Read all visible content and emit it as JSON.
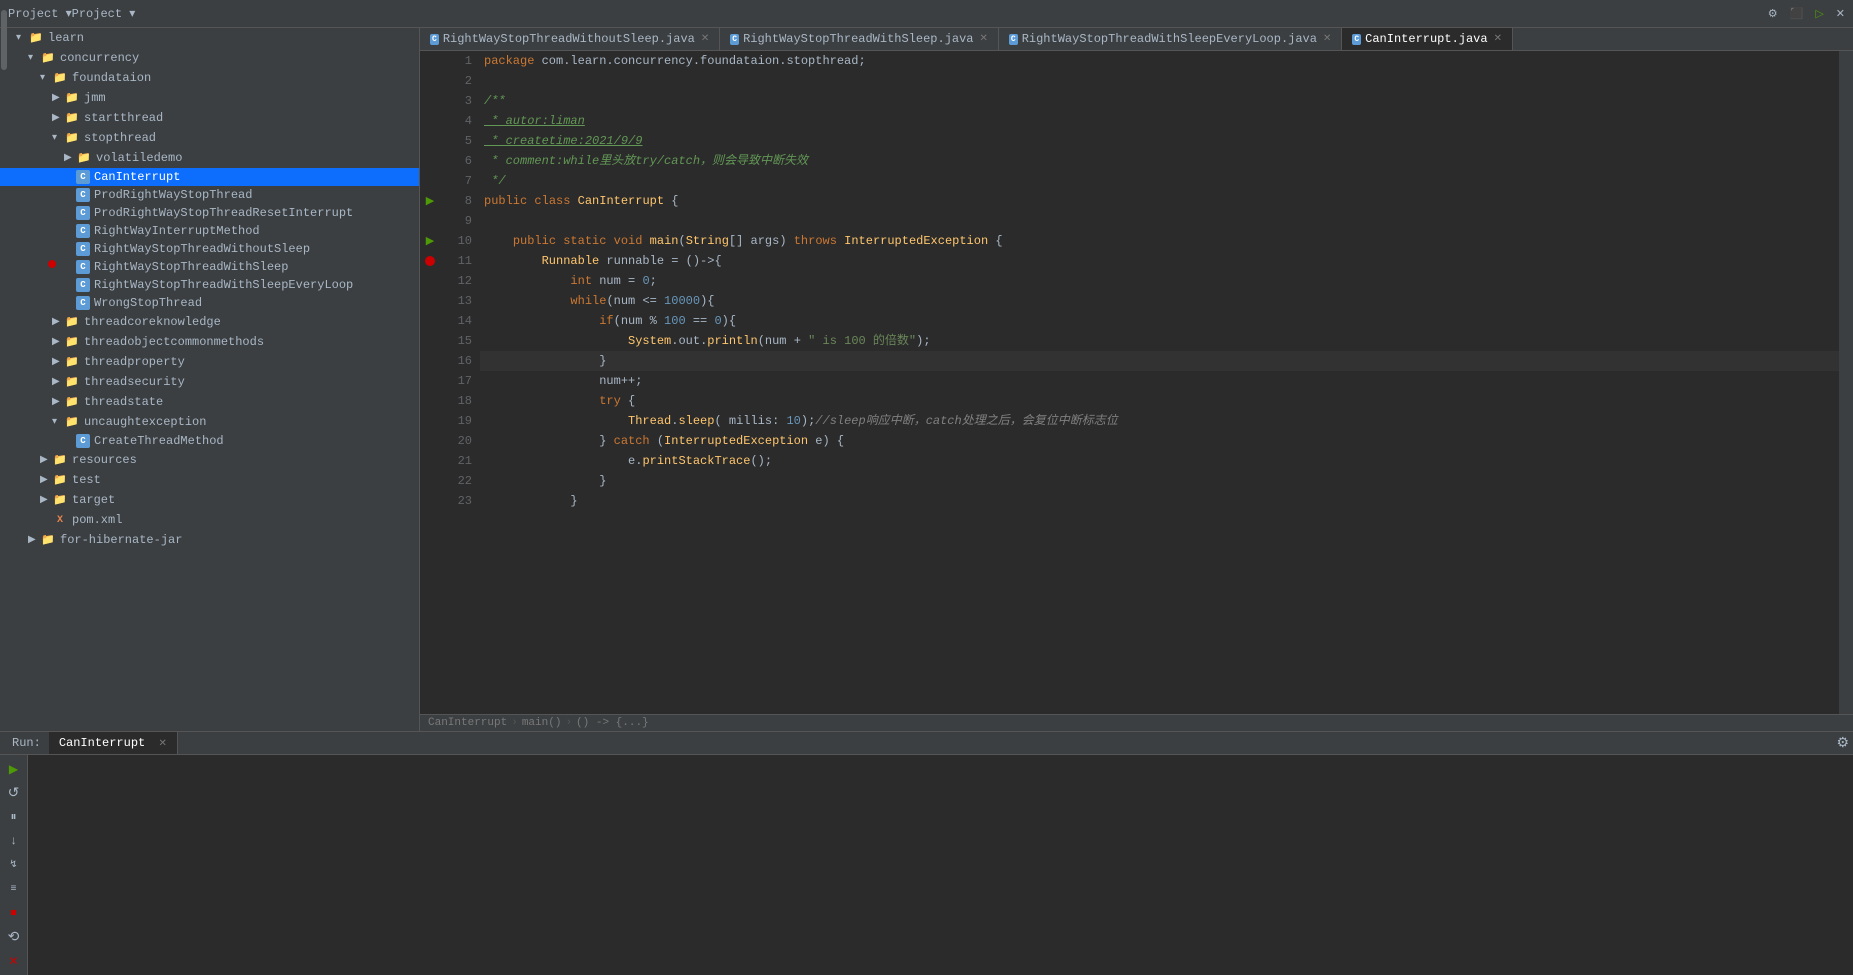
{
  "topbar": {
    "title": "Project ▾",
    "icons": [
      "⚙",
      "⬛",
      "▷",
      "✕"
    ]
  },
  "sidebar": {
    "items": [
      {
        "id": "learn",
        "label": "learn",
        "indent": 1,
        "type": "folder",
        "expanded": true,
        "arrow": "▾"
      },
      {
        "id": "concurrency",
        "label": "concurrency",
        "indent": 2,
        "type": "folder",
        "expanded": true,
        "arrow": "▾"
      },
      {
        "id": "foundataion",
        "label": "foundataion",
        "indent": 3,
        "type": "folder",
        "expanded": true,
        "arrow": "▾"
      },
      {
        "id": "jmm",
        "label": "jmm",
        "indent": 4,
        "type": "folder",
        "expanded": false,
        "arrow": "▶"
      },
      {
        "id": "startthread",
        "label": "startthread",
        "indent": 4,
        "type": "folder",
        "expanded": false,
        "arrow": "▶"
      },
      {
        "id": "stopthread",
        "label": "stopthread",
        "indent": 4,
        "type": "folder",
        "expanded": true,
        "arrow": "▾"
      },
      {
        "id": "volatiledemo",
        "label": "volatiledemo",
        "indent": 5,
        "type": "folder",
        "expanded": false,
        "arrow": "▶"
      },
      {
        "id": "CanInterrupt",
        "label": "CanInterrupt",
        "indent": 5,
        "type": "java",
        "selected": true
      },
      {
        "id": "ProdRightWayStopThread",
        "label": "ProdRightWayStopThread",
        "indent": 5,
        "type": "java"
      },
      {
        "id": "ProdRightWayStopThreadResetInterrupt",
        "label": "ProdRightWayStopThreadResetInterrupt",
        "indent": 5,
        "type": "java"
      },
      {
        "id": "RightWayInterruptMethod",
        "label": "RightWayInterruptMethod",
        "indent": 5,
        "type": "java"
      },
      {
        "id": "RightWayStopThreadWithoutSleep",
        "label": "RightWayStopThreadWithoutSleep",
        "indent": 5,
        "type": "java"
      },
      {
        "id": "RightWayStopThreadWithSleep",
        "label": "RightWayStopThreadWithSleep",
        "indent": 5,
        "type": "java"
      },
      {
        "id": "RightWayStopThreadWithSleepEveryLoop",
        "label": "RightWayStopThreadWithSleepEveryLoop",
        "indent": 5,
        "type": "java"
      },
      {
        "id": "WrongStopThread",
        "label": "WrongStopThread",
        "indent": 5,
        "type": "java"
      },
      {
        "id": "threadcoreknowledge",
        "label": "threadcoreknowledge",
        "indent": 4,
        "type": "folder",
        "expanded": false,
        "arrow": "▶"
      },
      {
        "id": "threadobjectcommonmethods",
        "label": "threadobjectcommonmethods",
        "indent": 4,
        "type": "folder",
        "expanded": false,
        "arrow": "▶"
      },
      {
        "id": "threadproperty",
        "label": "threadproperty",
        "indent": 4,
        "type": "folder",
        "expanded": false,
        "arrow": "▶"
      },
      {
        "id": "threadsecurity",
        "label": "threadsecurity",
        "indent": 4,
        "type": "folder",
        "expanded": false,
        "arrow": "▶"
      },
      {
        "id": "threadstate",
        "label": "threadstate",
        "indent": 4,
        "type": "folder",
        "expanded": false,
        "arrow": "▶"
      },
      {
        "id": "uncaughtexception",
        "label": "uncaughtexception",
        "indent": 4,
        "type": "folder",
        "expanded": true,
        "arrow": "▾"
      },
      {
        "id": "CreateThreadMethod",
        "label": "CreateThreadMethod",
        "indent": 5,
        "type": "java"
      },
      {
        "id": "resources",
        "label": "resources",
        "indent": 3,
        "type": "folder",
        "expanded": false,
        "arrow": "▶"
      },
      {
        "id": "test",
        "label": "test",
        "indent": 3,
        "type": "folder",
        "expanded": false,
        "arrow": "▶"
      },
      {
        "id": "target",
        "label": "target",
        "indent": 3,
        "type": "folder",
        "expanded": false,
        "arrow": "▶"
      },
      {
        "id": "pom.xml",
        "label": "pom.xml",
        "indent": 3,
        "type": "xml"
      },
      {
        "id": "for-hibernate-jar",
        "label": "for-hibernate-jar",
        "indent": 2,
        "type": "folder",
        "expanded": false,
        "arrow": "▶"
      }
    ]
  },
  "tabs": [
    {
      "id": "tab1",
      "label": "RightWayStopThreadWithoutSleep.java",
      "active": false,
      "closable": true
    },
    {
      "id": "tab2",
      "label": "RightWayStopThreadWithSleep.java",
      "active": false,
      "closable": true
    },
    {
      "id": "tab3",
      "label": "RightWayStopThreadWithSleepEveryLoop.java",
      "active": false,
      "closable": true
    },
    {
      "id": "tab4",
      "label": "CanInterrupt.java",
      "active": true,
      "closable": true
    }
  ],
  "code": {
    "lines": [
      {
        "num": 1,
        "gutter": "",
        "content": "package com.learn.concurrency.foundataion.stopthread;",
        "parts": [
          {
            "text": "package ",
            "cls": "kw"
          },
          {
            "text": "com.learn.concurrency.foundataion.stopthread",
            "cls": "pkg"
          },
          {
            "text": ";",
            "cls": "op"
          }
        ]
      },
      {
        "num": 2,
        "gutter": "",
        "content": "",
        "parts": []
      },
      {
        "num": 3,
        "gutter": "",
        "content": "/**",
        "parts": [
          {
            "text": "/**",
            "cls": "cmt-text"
          }
        ]
      },
      {
        "num": 4,
        "gutter": "",
        "content": " * autor:liman",
        "parts": [
          {
            "text": " * autor:liman",
            "cls": "cmt-link"
          }
        ]
      },
      {
        "num": 5,
        "gutter": "",
        "content": " * createtime:2021/9/9",
        "parts": [
          {
            "text": " * createtime:2021/9/9",
            "cls": "cmt-link"
          }
        ]
      },
      {
        "num": 6,
        "gutter": "",
        "content": " * comment:while里头放try/catch，则会导致中断失效",
        "parts": [
          {
            "text": " * comment:while里头放try/catch，则会导致中断失效",
            "cls": "cmt-text"
          }
        ]
      },
      {
        "num": 7,
        "gutter": "",
        "content": " */",
        "parts": [
          {
            "text": " */",
            "cls": "cmt-text"
          }
        ]
      },
      {
        "num": 8,
        "gutter": "run",
        "content": "public class CanInterrupt {",
        "parts": [
          {
            "text": "public ",
            "cls": "kw"
          },
          {
            "text": "class ",
            "cls": "kw"
          },
          {
            "text": "CanInterrupt",
            "cls": "cls"
          },
          {
            "text": " {",
            "cls": "op"
          }
        ]
      },
      {
        "num": 9,
        "gutter": "",
        "content": "",
        "parts": []
      },
      {
        "num": 10,
        "gutter": "run",
        "content": "    public static void main(String[] args) throws InterruptedException {",
        "parts": [
          {
            "text": "    "
          },
          {
            "text": "public ",
            "cls": "kw"
          },
          {
            "text": "static ",
            "cls": "kw"
          },
          {
            "text": "void ",
            "cls": "kw"
          },
          {
            "text": "main",
            "cls": "fn"
          },
          {
            "text": "("
          },
          {
            "text": "String",
            "cls": "cls"
          },
          {
            "text": "[] args) "
          },
          {
            "text": "throws ",
            "cls": "kw"
          },
          {
            "text": "InterruptedException",
            "cls": "cls"
          },
          {
            "text": " {"
          }
        ]
      },
      {
        "num": 11,
        "gutter": "break",
        "content": "        Runnable runnable = ()->{",
        "parts": [
          {
            "text": "        "
          },
          {
            "text": "Runnable",
            "cls": "cls"
          },
          {
            "text": " runnable = ()->{"
          }
        ]
      },
      {
        "num": 12,
        "gutter": "",
        "content": "            int num = 0;",
        "parts": [
          {
            "text": "            "
          },
          {
            "text": "int ",
            "cls": "kw"
          },
          {
            "text": "num = "
          },
          {
            "text": "0",
            "cls": "num"
          },
          {
            "text": ";"
          }
        ]
      },
      {
        "num": 13,
        "gutter": "",
        "content": "            while(num <= 10000){",
        "parts": [
          {
            "text": "            "
          },
          {
            "text": "while",
            "cls": "kw"
          },
          {
            "text": "(num <= "
          },
          {
            "text": "10000",
            "cls": "num"
          },
          {
            "text": "){"
          }
        ]
      },
      {
        "num": 14,
        "gutter": "",
        "content": "                if(num % 100 == 0){",
        "parts": [
          {
            "text": "                "
          },
          {
            "text": "if",
            "cls": "kw"
          },
          {
            "text": "(num % "
          },
          {
            "text": "100",
            "cls": "num"
          },
          {
            "text": " == "
          },
          {
            "text": "0",
            "cls": "num"
          },
          {
            "text": "){"
          }
        ]
      },
      {
        "num": 15,
        "gutter": "",
        "content": "                    System.out.println(num + \" is 100 的倍数\");",
        "parts": [
          {
            "text": "                    "
          },
          {
            "text": "System",
            "cls": "cls"
          },
          {
            "text": "."
          },
          {
            "text": "out",
            "cls": "var"
          },
          {
            "text": "."
          },
          {
            "text": "println",
            "cls": "fn"
          },
          {
            "text": "(num + "
          },
          {
            "text": "\" is 100 的倍数\"",
            "cls": "str"
          },
          {
            "text": ");"
          }
        ]
      },
      {
        "num": 16,
        "gutter": "",
        "content": "                }",
        "parts": [
          {
            "text": "                }"
          }
        ]
      },
      {
        "num": 17,
        "gutter": "",
        "content": "                num++;",
        "parts": [
          {
            "text": "                num++;"
          }
        ]
      },
      {
        "num": 18,
        "gutter": "",
        "content": "                try {",
        "parts": [
          {
            "text": "                "
          },
          {
            "text": "try",
            "cls": "kw"
          },
          {
            "text": " {"
          }
        ]
      },
      {
        "num": 19,
        "gutter": "",
        "content": "                    Thread.sleep( millis: 10);//sleep响应中断，catch处理之后，会复位中断标志位",
        "parts": [
          {
            "text": "                    "
          },
          {
            "text": "Thread",
            "cls": "cls"
          },
          {
            "text": "."
          },
          {
            "text": "sleep",
            "cls": "fn"
          },
          {
            "text": "( millis: "
          },
          {
            "text": "10",
            "cls": "num"
          },
          {
            "text": ");"
          },
          {
            "text": "//sleep响应中断，catch处理之后，会复位中断标志位",
            "cls": "cm"
          }
        ]
      },
      {
        "num": 20,
        "gutter": "",
        "content": "                } catch (InterruptedException e) {",
        "parts": [
          {
            "text": "                "
          },
          {
            "text": "} "
          },
          {
            "text": "catch ",
            "cls": "kw"
          },
          {
            "text": "("
          },
          {
            "text": "InterruptedException",
            "cls": "cls"
          },
          {
            "text": " e) {"
          }
        ]
      },
      {
        "num": 21,
        "gutter": "",
        "content": "                    e.printStackTrace();",
        "parts": [
          {
            "text": "                    e."
          },
          {
            "text": "printStackTrace",
            "cls": "fn"
          },
          {
            "text": "();"
          }
        ]
      },
      {
        "num": 22,
        "gutter": "",
        "content": "                }",
        "parts": [
          {
            "text": "                }"
          }
        ]
      },
      {
        "num": 23,
        "gutter": "",
        "content": "            }",
        "parts": [
          {
            "text": "            }"
          }
        ]
      }
    ]
  },
  "breadcrumb": {
    "parts": [
      "CanInterrupt",
      "main()",
      "() -> {...}"
    ]
  },
  "run": {
    "label": "Run:",
    "tab": "CanInterrupt",
    "buttons": [
      {
        "icon": "▶",
        "label": "run",
        "color": "green"
      },
      {
        "icon": "⟳",
        "label": "rerun",
        "color": ""
      },
      {
        "icon": "⏸",
        "label": "pause",
        "color": ""
      },
      {
        "icon": "⬇",
        "label": "step-over",
        "color": ""
      },
      {
        "icon": "⬇",
        "label": "step-into",
        "color": ""
      },
      {
        "icon": "⬇",
        "label": "step-out",
        "color": ""
      },
      {
        "icon": "⏹",
        "label": "stop",
        "color": "red"
      },
      {
        "icon": "⟲",
        "label": "restore",
        "color": ""
      },
      {
        "icon": "✕",
        "label": "close",
        "color": "red"
      }
    ]
  }
}
